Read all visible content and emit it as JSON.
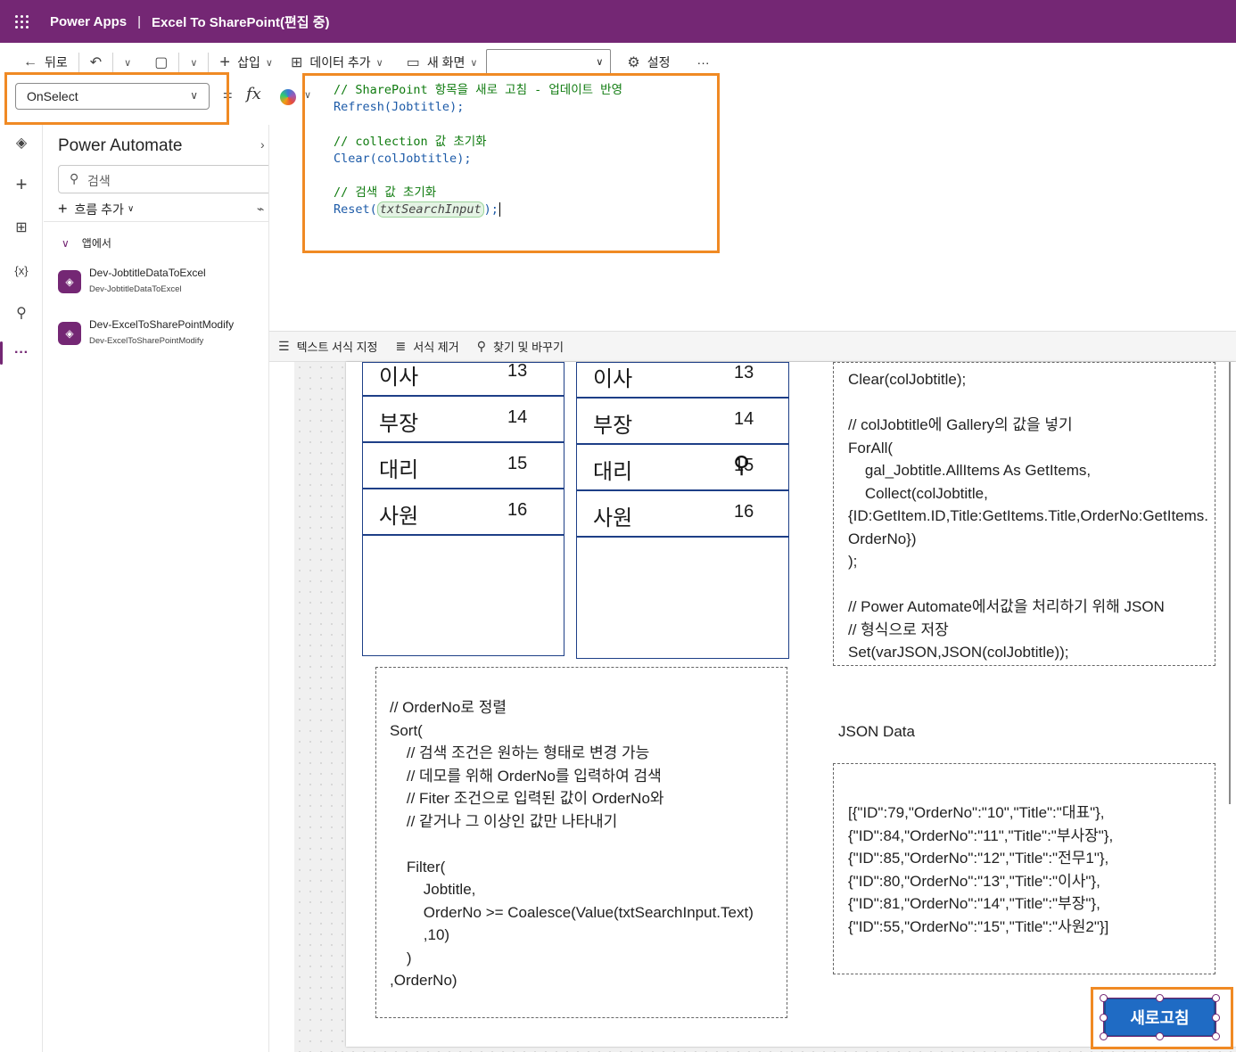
{
  "titlebar": {
    "app_name": "Power Apps",
    "separator": "|",
    "document_title": "Excel To SharePoint(편집 중)"
  },
  "commandbar": {
    "back": "뒤로",
    "insert": "삽입",
    "add_data": "데이터 추가",
    "new_screen": "새 화면",
    "screen_selector_value": "",
    "settings": "설정",
    "more": "···"
  },
  "formulabar": {
    "property": "OnSelect",
    "equals": "=",
    "fx": "fx",
    "code_lines": [
      {
        "comment": "// SharePoint 항목을 새로 고침 - 업데이트 반영"
      },
      {
        "fn": "Refresh",
        "arg": "Jobtitle",
        "tail": ");"
      },
      {
        "blank": ""
      },
      {
        "comment": "// collection 값 초기화"
      },
      {
        "fn": "Clear",
        "arg": "colJobtitle",
        "tail": ");"
      },
      {
        "blank": ""
      },
      {
        "comment": "// 검색 값 초기화"
      },
      {
        "fn": "Reset",
        "arg": "txtSearchInput",
        "tail": ");"
      }
    ],
    "line1": "// SharePoint 항목을 새로 고침 - 업데이트 반영",
    "line2_fn": "Refresh(",
    "line2_arg": "Jobtitle",
    "line2_tail": ");",
    "line4": "// collection 값 초기화",
    "line5_fn": "Clear(",
    "line5_arg": "colJobtitle",
    "line5_tail": ");",
    "line7": "// 검색 값 초기화",
    "line8_fn": "Reset(",
    "line8_arg": "txtSearchInput",
    "line8_tail": ");"
  },
  "format_toolbar": {
    "format_text": "텍스트 서식 지정",
    "remove_format": "서식 제거",
    "find_replace": "찾기 및 바꾸기"
  },
  "rail": {
    "icons": [
      "layers-icon",
      "plus-icon",
      "table-icon",
      "variables-icon",
      "search-icon",
      "more-icon"
    ],
    "variables_label": "{x}",
    "more_label": "···"
  },
  "side_pane": {
    "title": "Power Automate",
    "search_placeholder": "검색",
    "add_flow": "흐름 추가",
    "section": "앱에서",
    "flows": [
      {
        "name": "Dev-JobtitleDataToExcel",
        "sub": "Dev-JobtitleDataToExcel"
      },
      {
        "name": "Dev-ExcelToSharePointModify",
        "sub": "Dev-ExcelToSharePointModify"
      }
    ]
  },
  "gallery_left": {
    "rows": [
      {
        "title": "이사",
        "order": "13"
      },
      {
        "title": "부장",
        "order": "14"
      },
      {
        "title": "대리",
        "order": "15"
      },
      {
        "title": "사원",
        "order": "16"
      }
    ]
  },
  "gallery_right": {
    "rows": [
      {
        "title": "이사",
        "order": "13"
      },
      {
        "title": "부장",
        "order": "14"
      },
      {
        "title": "대리",
        "order": "15"
      },
      {
        "title": "사원",
        "order": "16"
      }
    ]
  },
  "code_box_right_top": "Clear(colJobtitle);\n\n// colJobtitle에 Gallery의 값을 넣기\nForAll(\n    gal_Jobtitle.AllItems As GetItems,\n    Collect(colJobtitle,\n{ID:GetItem.ID,Title:GetItems.Title,OrderNo:GetItems.\nOrderNo})\n);\n\n// Power Automate에서값을 처리하기 위해 JSON\n// 형식으로 저장\nSet(varJSON,JSON(colJobtitle));",
  "code_box_bottom_left": "// OrderNo로 정렬\nSort(\n    // 검색 조건은 원하는 형태로 변경 가능\n    // 데모를 위해 OrderNo를 입력하여 검색\n    // Fiter 조건으로 입력된 값이 OrderNo와\n    // 같거나 그 이상인 값만 나타내기\n\n    Filter(\n        Jobtitle,\n        OrderNo >= Coalesce(Value(txtSearchInput.Text)\n        ,10)\n    )\n,OrderNo)",
  "json_label": "JSON Data",
  "json_text": "[{\"ID\":79,\"OrderNo\":\"10\",\"Title\":\"대표\"},\n{\"ID\":84,\"OrderNo\":\"11\",\"Title\":\"부사장\"},\n{\"ID\":85,\"OrderNo\":\"12\",\"Title\":\"전무1\"},\n{\"ID\":80,\"OrderNo\":\"13\",\"Title\":\"이사\"},\n{\"ID\":81,\"OrderNo\":\"14\",\"Title\":\"부장\"},\n{\"ID\":55,\"OrderNo\":\"15\",\"Title\":\"사원2\"}]",
  "refresh_button": "새로고침",
  "colors": {
    "brand": "#742774",
    "highlight": "#f08a24",
    "gallery_border": "#1e3f87",
    "button": "#1f6bc4"
  }
}
